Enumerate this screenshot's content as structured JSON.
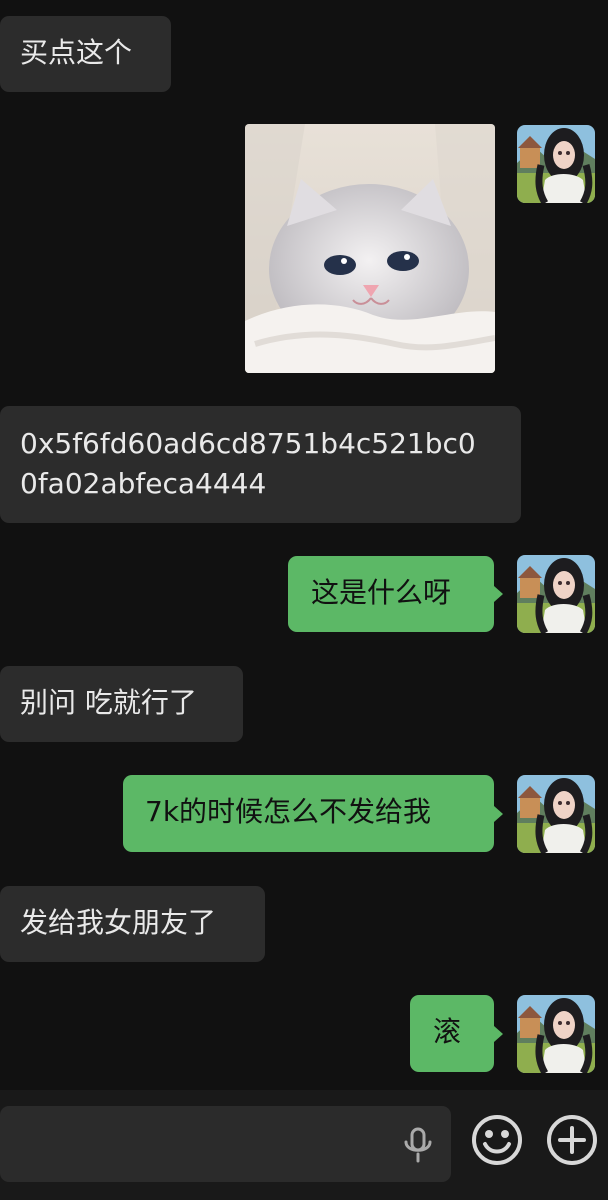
{
  "messages": [
    {
      "side": "left",
      "type": "text",
      "text": "买点这个"
    },
    {
      "side": "right",
      "type": "image",
      "image_name": "kitten-sticker"
    },
    {
      "side": "left",
      "type": "text",
      "text_line1": "0x5f6fd60ad6cd8751b4c521bc0",
      "text_line2": "0fa02abfeca4444"
    },
    {
      "side": "right",
      "type": "text",
      "text": "这是什么呀"
    },
    {
      "side": "left",
      "type": "text",
      "text": "别问 吃就行了"
    },
    {
      "side": "right",
      "type": "text",
      "text": "7k的时候怎么不发给我"
    },
    {
      "side": "left",
      "type": "text",
      "text": "发给我女朋友了"
    },
    {
      "side": "right",
      "type": "text",
      "text": "滚"
    }
  ],
  "composer": {
    "input_value": "",
    "icons": [
      "microphone-icon",
      "emoji-icon",
      "plus-icon"
    ]
  },
  "colors": {
    "background": "#111111",
    "incoming_bubble": "#2c2c2c",
    "outgoing_bubble": "#5cb866",
    "composer": "#191919"
  }
}
